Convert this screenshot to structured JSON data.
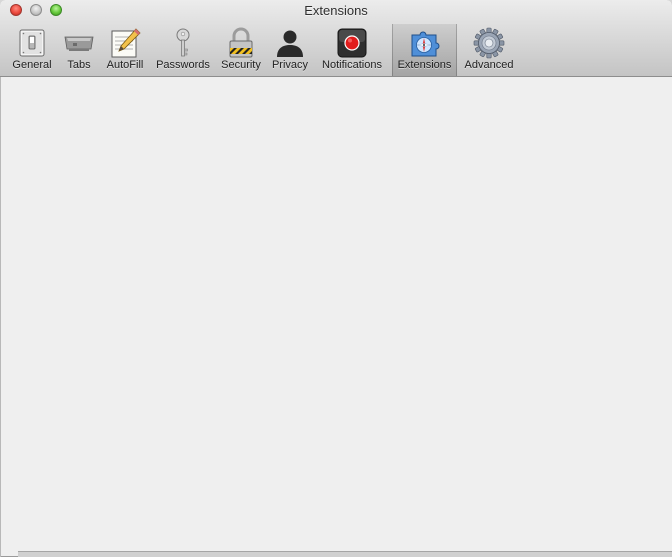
{
  "window": {
    "title": "Extensions"
  },
  "toolbar": {
    "items": [
      {
        "label": "General",
        "icon": "general-switch-icon"
      },
      {
        "label": "Tabs",
        "icon": "tabs-icon"
      },
      {
        "label": "AutoFill",
        "icon": "autofill-pencil-icon"
      },
      {
        "label": "Passwords",
        "icon": "key-icon"
      },
      {
        "label": "Security",
        "icon": "padlock-icon"
      },
      {
        "label": "Privacy",
        "icon": "person-silhouette-icon"
      },
      {
        "label": "Notifications",
        "icon": "notification-record-icon"
      },
      {
        "label": "Extensions",
        "icon": "puzzle-compass-icon",
        "selected": true
      },
      {
        "label": "Advanced",
        "icon": "gear-icon"
      }
    ]
  },
  "colors": {
    "close": "#ec4a3e",
    "minimize": "#c8c8c8",
    "zoom": "#64c83a",
    "content_bg": "#efefef"
  }
}
